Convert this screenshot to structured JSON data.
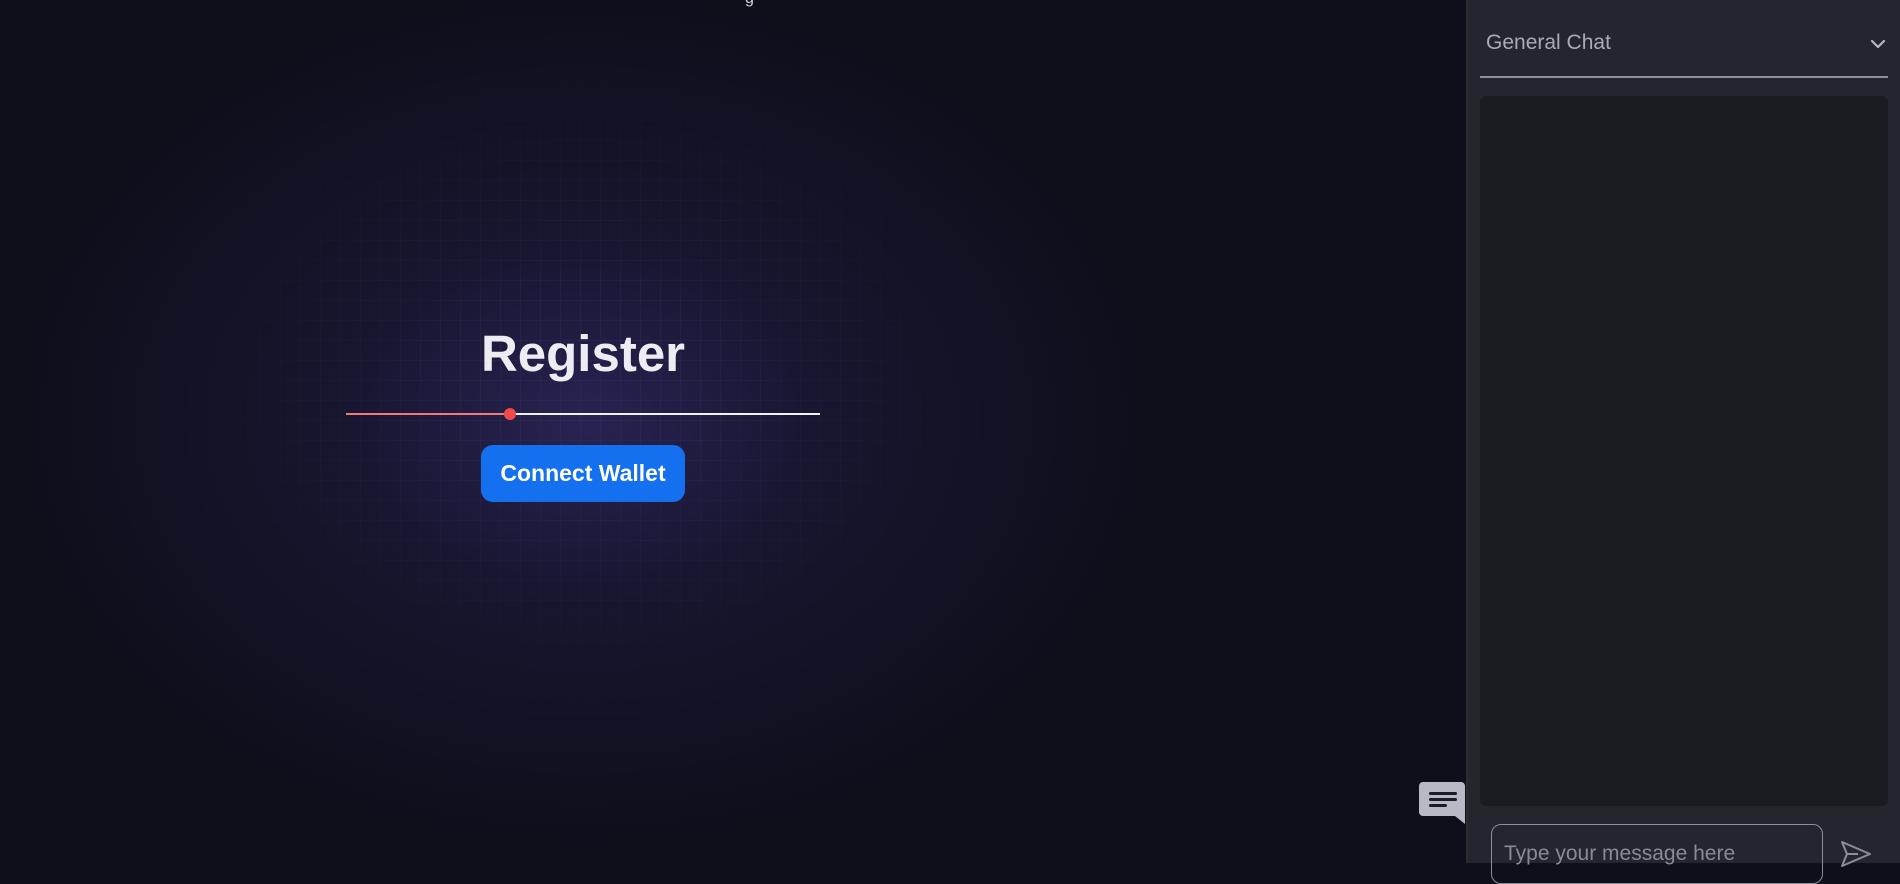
{
  "main": {
    "top_fragment": "g",
    "title": "Register",
    "progress_fraction": 0.346,
    "connect_button_label": "Connect Wallet"
  },
  "chat": {
    "channel": "General Chat",
    "input_placeholder": "Type your message here",
    "toggle_icon": "chat-bubble-icon",
    "send_icon": "send-icon"
  },
  "colors": {
    "background": "#0e0f1b",
    "accent_button": "#1470ef",
    "progress_fill": "#f07a7a",
    "progress_knob": "#ef4b4b",
    "panel": "#25252e",
    "messages_area": "#1b1c22"
  }
}
